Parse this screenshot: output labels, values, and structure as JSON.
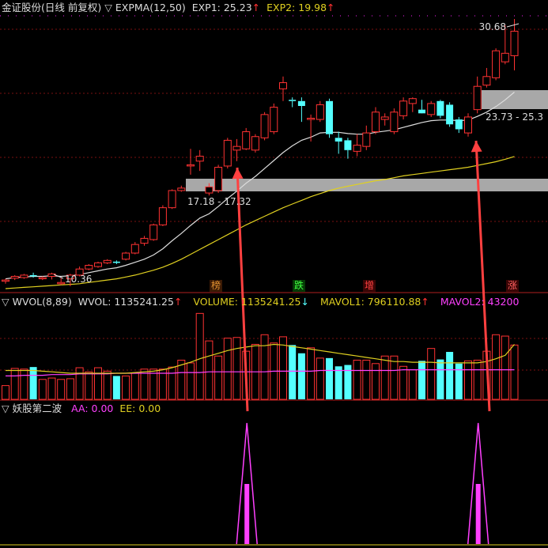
{
  "colors": {
    "up": "#ff3232",
    "down": "#54ffff",
    "exp1": "#dddddd",
    "exp2": "#e0d020",
    "mavol1": "#e0d020",
    "mavol2": "#ff40ff",
    "signal": "#ff40ff",
    "grid": "#7a1010",
    "arrow": "#ff4040",
    "band": "#a8a8a8",
    "text_white": "#dddddd",
    "text_yellow": "#e0d020",
    "text_magenta": "#ff40ff",
    "text_red": "#ff3232",
    "text_cyan": "#54ffff"
  },
  "main_header": {
    "stock_name": "金证股份(日线 前复权)",
    "indicator": "EXPMA(12,50)",
    "exp1_label": "EXP1: 25.23",
    "exp1_arrow": "↑",
    "exp2_label": "EXP2: 19.98",
    "exp2_arrow": "↑"
  },
  "price_labels": {
    "high": "30.68",
    "low": "10.36",
    "band_low": "17.18 - 17.32",
    "band_high": "23.73 - 25.3"
  },
  "event_tags": [
    {
      "text": "榜",
      "color": "#e09030"
    },
    {
      "text": "跌",
      "color": "#40ff40"
    },
    {
      "text": "增",
      "color": "#ff4040"
    },
    {
      "text": "涨",
      "color": "#ff6060"
    }
  ],
  "vol_header": {
    "indicator": "WVOL(8,89)",
    "wvol": "WVOL: 1135241.25",
    "wvol_arrow": "↑",
    "volume": "VOLUME: 1135241.25",
    "volume_arrow": "↓",
    "mavol1": "MAVOL1: 796110.88",
    "mavol1_arrow": "↑",
    "mavol2": "MAVOL2: 43200"
  },
  "sig_header": {
    "indicator": "妖股第二波",
    "aa": "AA: 0.00",
    "ee": "EE: 0.00"
  },
  "chart_data": [
    {
      "type": "candlestick",
      "title": "金证股份(日线 前复权)",
      "candles": [
        [
          9.8,
          10.0,
          9.6,
          9.9
        ],
        [
          10.05,
          10.3,
          9.9,
          10.2
        ],
        [
          10.1,
          10.4,
          10.0,
          10.3
        ],
        [
          10.3,
          10.5,
          10.1,
          10.25
        ],
        [
          10.05,
          10.2,
          9.9,
          10.1
        ],
        [
          10.2,
          10.5,
          9.95,
          10.4
        ],
        [
          9.6,
          10.1,
          9.5,
          9.7
        ],
        [
          10.0,
          10.4,
          9.4,
          10.3
        ],
        [
          10.3,
          11.0,
          10.2,
          10.8
        ],
        [
          10.8,
          11.2,
          10.7,
          11.1
        ],
        [
          11.0,
          11.4,
          10.9,
          11.3
        ],
        [
          11.3,
          11.6,
          11.2,
          11.5
        ],
        [
          11.4,
          11.5,
          11.2,
          11.3
        ],
        [
          11.6,
          12.2,
          11.5,
          12.1
        ],
        [
          12.1,
          13.0,
          12.0,
          12.8
        ],
        [
          12.9,
          13.5,
          12.7,
          13.3
        ],
        [
          13.2,
          14.5,
          13.1,
          14.4
        ],
        [
          14.4,
          16.0,
          14.3,
          15.8
        ],
        [
          15.8,
          17.3,
          15.7,
          17.2
        ],
        [
          17.2,
          17.6,
          17.1,
          17.4
        ],
        [
          19.3,
          20.6,
          18.5,
          19.3
        ],
        [
          19.6,
          20.5,
          18.8,
          20.0
        ],
        [
          17.0,
          17.8,
          16.8,
          17.5
        ],
        [
          17.2,
          19.3,
          17.0,
          19.1
        ],
        [
          19.2,
          21.5,
          19.0,
          21.3
        ],
        [
          20.5,
          21.4,
          19.6,
          20.8
        ],
        [
          20.6,
          22.3,
          20.5,
          22.0
        ],
        [
          20.5,
          21.8,
          20.3,
          21.6
        ],
        [
          21.5,
          23.6,
          21.3,
          23.4
        ],
        [
          22.0,
          24.3,
          21.8,
          24.0
        ],
        [
          25.5,
          26.5,
          24.5,
          26.0
        ],
        [
          24.6,
          24.8,
          24.0,
          24.5
        ],
        [
          24.5,
          24.8,
          22.8,
          24.1
        ],
        [
          23.0,
          23.4,
          21.2,
          23.1
        ],
        [
          23.0,
          24.5,
          22.8,
          24.2
        ],
        [
          24.5,
          24.7,
          21.5,
          21.8
        ],
        [
          21.5,
          22.0,
          20.2,
          21.2
        ],
        [
          21.3,
          21.5,
          19.8,
          20.5
        ],
        [
          20.4,
          21.8,
          20.0,
          20.9
        ],
        [
          20.8,
          22.5,
          20.5,
          21.9
        ],
        [
          22.0,
          24.0,
          21.8,
          23.6
        ],
        [
          23.0,
          23.5,
          22.5,
          23.2
        ],
        [
          22.0,
          23.9,
          21.8,
          23.6
        ],
        [
          23.3,
          24.8,
          23.0,
          24.5
        ],
        [
          24.3,
          24.8,
          23.6,
          24.7
        ],
        [
          23.8,
          24.6,
          23.6,
          23.5
        ],
        [
          23.4,
          24.5,
          23.2,
          24.3
        ],
        [
          24.5,
          24.6,
          23.1,
          23.3
        ],
        [
          24.2,
          24.4,
          22.4,
          22.6
        ],
        [
          23.0,
          23.2,
          21.9,
          22.2
        ],
        [
          21.9,
          23.5,
          21.6,
          23.2
        ],
        [
          23.8,
          26.5,
          23.5,
          25.7
        ],
        [
          25.8,
          27.2,
          25.6,
          26.5
        ],
        [
          26.4,
          28.8,
          26.2,
          28.6
        ],
        [
          27.7,
          30.7,
          27.5,
          28.4
        ],
        [
          28.2,
          31.2,
          27.0,
          30.2
        ]
      ],
      "exp1_line": [
        10.0,
        10.1,
        10.15,
        10.2,
        10.2,
        10.25,
        10.2,
        10.25,
        10.35,
        10.5,
        10.65,
        10.8,
        10.9,
        11.1,
        11.35,
        11.6,
        11.95,
        12.45,
        13.1,
        13.7,
        14.35,
        14.95,
        15.3,
        15.9,
        16.55,
        17.15,
        17.8,
        18.35,
        19.0,
        19.65,
        20.3,
        20.85,
        21.3,
        21.55,
        21.9,
        21.95,
        21.95,
        21.85,
        21.8,
        21.8,
        21.95,
        22.05,
        22.15,
        22.35,
        22.55,
        22.75,
        22.9,
        22.95,
        22.95,
        22.9,
        22.95,
        23.25,
        23.6,
        24.05,
        24.6,
        25.23
      ],
      "exp2_line": [
        9.2,
        9.25,
        9.3,
        9.35,
        9.4,
        9.45,
        9.5,
        9.55,
        9.6,
        9.7,
        9.8,
        9.9,
        10.0,
        10.15,
        10.3,
        10.5,
        10.7,
        10.95,
        11.25,
        11.6,
        12.0,
        12.4,
        12.8,
        13.2,
        13.6,
        14.0,
        14.4,
        14.75,
        15.1,
        15.45,
        15.8,
        16.1,
        16.4,
        16.7,
        16.95,
        17.2,
        17.4,
        17.55,
        17.7,
        17.85,
        18.0,
        18.1,
        18.25,
        18.4,
        18.5,
        18.6,
        18.7,
        18.8,
        18.9,
        19.0,
        19.1,
        19.25,
        19.4,
        19.55,
        19.75,
        19.98
      ],
      "support_bands": [
        [
          17.18,
          17.32
        ],
        [
          23.73,
          25.3
        ]
      ],
      "y_high": 30.68,
      "y_low": 10.36
    },
    {
      "type": "bar",
      "title": "WVOL(8,89)",
      "volumes": [
        0.2,
        0.45,
        0.44,
        0.47,
        0.29,
        0.31,
        0.29,
        0.3,
        0.46,
        0.4,
        0.46,
        0.41,
        0.34,
        0.34,
        0.38,
        0.44,
        0.44,
        0.44,
        0.47,
        0.57,
        0.53,
        1.25,
        0.85,
        0.63,
        0.89,
        0.9,
        0.7,
        0.8,
        0.94,
        0.82,
        0.91,
        0.79,
        0.67,
        0.75,
        0.6,
        0.6,
        0.48,
        0.5,
        0.57,
        0.57,
        0.52,
        0.63,
        0.63,
        0.48,
        0.43,
        0.56,
        0.74,
        0.58,
        0.69,
        0.52,
        0.56,
        0.57,
        0.7,
        0.94,
        0.92,
        0.79
      ],
      "mavol1_line": [
        0.42,
        0.42,
        0.42,
        0.42,
        0.41,
        0.4,
        0.39,
        0.38,
        0.38,
        0.38,
        0.38,
        0.38,
        0.38,
        0.38,
        0.39,
        0.4,
        0.41,
        0.43,
        0.46,
        0.5,
        0.54,
        0.59,
        0.63,
        0.67,
        0.71,
        0.74,
        0.76,
        0.78,
        0.78,
        0.8,
        0.79,
        0.77,
        0.75,
        0.73,
        0.71,
        0.69,
        0.67,
        0.65,
        0.63,
        0.61,
        0.59,
        0.57,
        0.55,
        0.55,
        0.54,
        0.54,
        0.54,
        0.53,
        0.53,
        0.53,
        0.53,
        0.53,
        0.55,
        0.59,
        0.64,
        0.8
      ],
      "mavol2_line": [
        0.34,
        0.34,
        0.35,
        0.35,
        0.35,
        0.36,
        0.36,
        0.36,
        0.37,
        0.37,
        0.37,
        0.37,
        0.38,
        0.38,
        0.38,
        0.38,
        0.38,
        0.38,
        0.38,
        0.39,
        0.39,
        0.39,
        0.4,
        0.4,
        0.4,
        0.4,
        0.4,
        0.4,
        0.4,
        0.41,
        0.41,
        0.41,
        0.41,
        0.41,
        0.42,
        0.42,
        0.42,
        0.42,
        0.42,
        0.42,
        0.42,
        0.42,
        0.42,
        0.43,
        0.43,
        0.43,
        0.43,
        0.43,
        0.43,
        0.43,
        0.43,
        0.43,
        0.43,
        0.43,
        0.43,
        0.43
      ],
      "vol_scale_max": 1.3,
      "unit": "relative"
    },
    {
      "type": "signal",
      "title": "妖股第二波",
      "peaks": [
        {
          "index": 26,
          "value": 1.0
        },
        {
          "index": 51,
          "value": 1.0
        }
      ]
    }
  ]
}
